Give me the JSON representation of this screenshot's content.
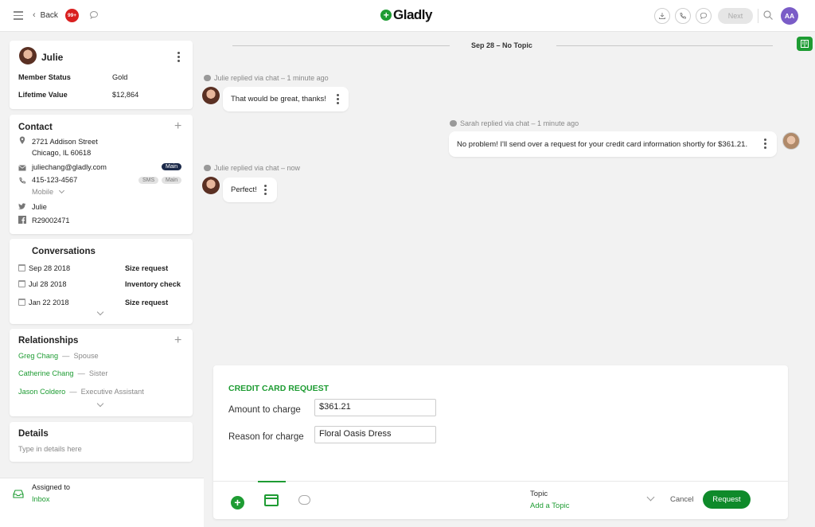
{
  "topbar": {
    "back_label": "Back",
    "badge_count": "99+",
    "logo_text": "Gladly",
    "next_label": "Next",
    "user_initials": "AA"
  },
  "customer": {
    "name": "Julie",
    "member_status_label": "Member Status",
    "member_status_value": "Gold",
    "lifetime_value_label": "Lifetime Value",
    "lifetime_value_value": "$12,864"
  },
  "contact": {
    "title": "Contact",
    "address_line1": "2721 Addison Street",
    "address_line2": "Chicago, IL 60618",
    "email": "juliechang@gladly.com",
    "email_tag": "Main",
    "phone": "415-123-4567",
    "phone_tag_sms": "SMS",
    "phone_tag_main": "Main",
    "phone_type": "Mobile",
    "twitter": "Julie",
    "facebook": "R29002471"
  },
  "conversations": {
    "title": "Conversations",
    "items": [
      {
        "date": "Sep 28 2018",
        "topic": "Size request"
      },
      {
        "date": "Jul 28 2018",
        "topic": "Inventory check"
      },
      {
        "date": "Jan 22 2018",
        "topic": "Size request"
      }
    ]
  },
  "relationships": {
    "title": "Relationships",
    "items": [
      {
        "name": "Greg Chang",
        "relation": "Spouse"
      },
      {
        "name": "Catherine Chang",
        "relation": "Sister"
      },
      {
        "name": "Jason Coldero",
        "relation": "Executive Assistant"
      }
    ]
  },
  "details": {
    "title": "Details",
    "placeholder": "Type in details here"
  },
  "assigned": {
    "label": "Assigned to",
    "value": "Inbox"
  },
  "thread": {
    "date_header": "Sep 28 – No Topic",
    "messages": [
      {
        "meta": "Julie replied via chat – 1 minute ago",
        "text": "That would be great, thanks!"
      },
      {
        "meta": "Sarah replied via chat – 1 minute ago",
        "text": "No problem! I'll send over a request for your credit card information shortly for $361.21."
      },
      {
        "meta": "Julie replied via chat – now",
        "text": "Perfect!"
      }
    ]
  },
  "composer": {
    "title": "CREDIT CARD REQUEST",
    "amount_label": "Amount to charge",
    "amount_value": "$361.21",
    "reason_label": "Reason for charge",
    "reason_value": "Floral Oasis Dress",
    "topic_label": "Topic",
    "topic_value": "Add a Topic",
    "cancel_label": "Cancel",
    "request_label": "Request"
  },
  "colors": {
    "brand_green": "#1e9c33",
    "badge_red": "#d92020",
    "avatar_purple": "#7a5cc7"
  }
}
